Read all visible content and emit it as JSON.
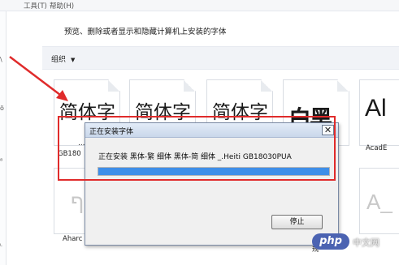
{
  "menu": [
    "工具(T)",
    "帮助(H)"
  ],
  "page_title": "预览、删除或者显示和隐藏计算机上安装的字体",
  "toolbar": {
    "organize_label": "组织"
  },
  "left_nav": {
    "glyphs": [
      "\\",
      "ö",
      "⁸",
      "ᴸ"
    ]
  },
  "tiles": [
    {
      "sample": "简体字",
      "label": "…H"
    },
    {
      "sample": "简体字",
      "label": ""
    },
    {
      "sample": "简体字",
      "label": ""
    },
    {
      "sample": "白黑",
      "label": ""
    },
    {
      "sample": "Al",
      "label": "AcadE"
    },
    {
      "sample": "ף",
      "label": "Aharc"
    },
    {
      "sample": "A_",
      "label": "规"
    }
  ],
  "partial_label_left": "GB180",
  "dialog": {
    "title": "正在安装字体",
    "close_glyph": "✕",
    "status": "正在安装 黑体-繁 细体  黑体-简 细体 _.Heiti GB18030PUA",
    "progress": 1.0,
    "stop_label": "停止"
  },
  "watermark": {
    "logo": "php",
    "text": "中文网"
  },
  "colors": {
    "highlight": "#e02b2b",
    "progress": "#3e8ee8",
    "titlebar": "#c9d7ea"
  }
}
